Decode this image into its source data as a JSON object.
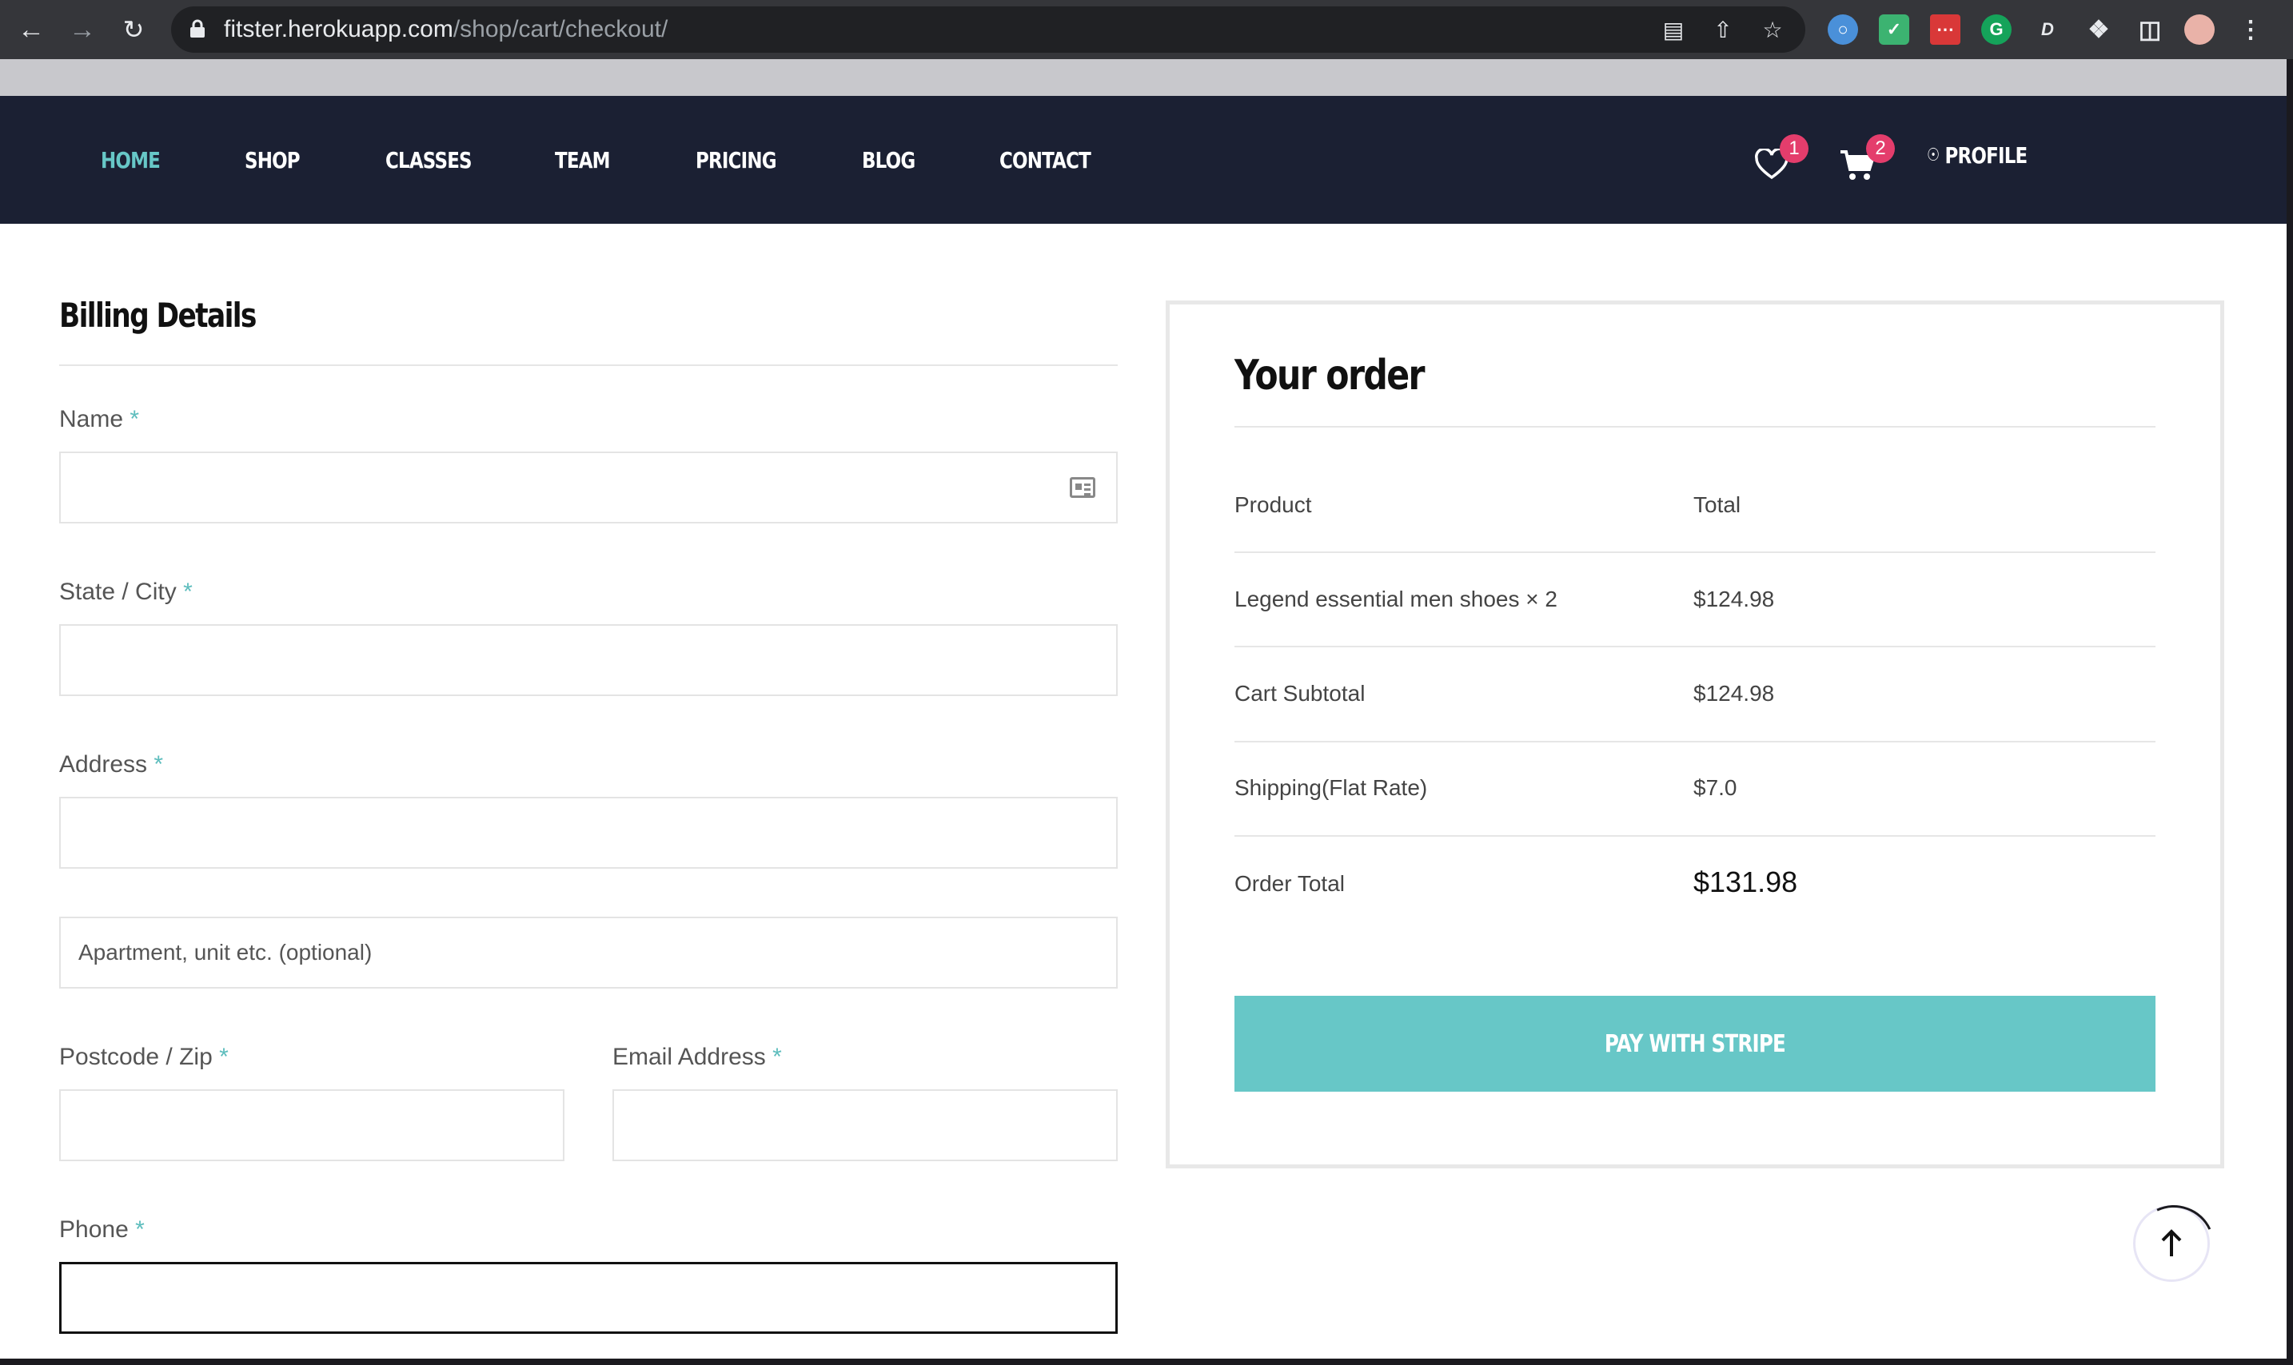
{
  "browser": {
    "url_domain": "fitster.herokuapp.com",
    "url_path": "/shop/cart/checkout/"
  },
  "nav": {
    "items": [
      {
        "label": "HOME",
        "active": true
      },
      {
        "label": "SHOP"
      },
      {
        "label": "CLASSES"
      },
      {
        "label": "TEAM"
      },
      {
        "label": "PRICING"
      },
      {
        "label": "BLOG"
      },
      {
        "label": "CONTACT"
      }
    ],
    "wishlist_count": "1",
    "cart_count": "2",
    "profile_label": "PROFILE"
  },
  "billing": {
    "title": "Billing Details",
    "name_label": "Name",
    "state_label": "State / City",
    "address_label": "Address",
    "apartment_placeholder": "Apartment, unit etc. (optional)",
    "postcode_label": "Postcode / Zip",
    "email_label": "Email Address",
    "phone_label": "Phone",
    "required_mark": "*"
  },
  "order": {
    "title": "Your order",
    "col_product": "Product",
    "col_total": "Total",
    "rows": [
      {
        "label": "Legend essential men shoes × 2",
        "value": "$124.98"
      },
      {
        "label": "Cart Subtotal",
        "value": "$124.98"
      },
      {
        "label": "Shipping(Flat Rate)",
        "value": "$7.0"
      }
    ],
    "total_label": "Order Total",
    "total_value": "$131.98",
    "pay_button": "PAY WITH STRIPE"
  },
  "colors": {
    "accent": "#67c7c7",
    "nav_bg": "#1b2033",
    "badge": "#e43d6c"
  }
}
